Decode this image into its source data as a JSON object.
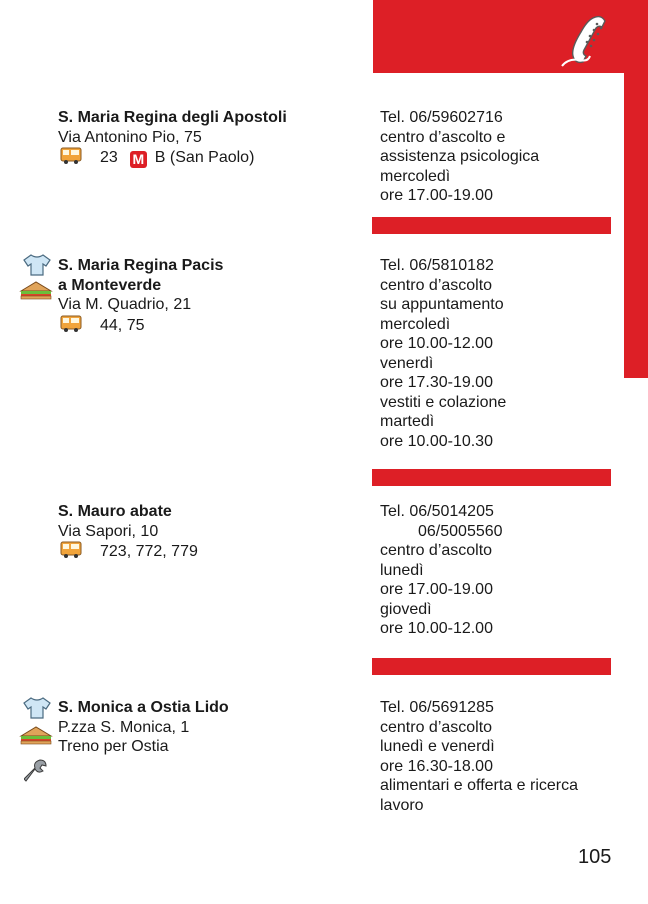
{
  "entries": [
    {
      "title": [
        "S. Maria Regina degli Apostoli"
      ],
      "address": "Via Antonino Pio, 75",
      "transport": {
        "bus": "23",
        "metro_symbol": "M",
        "metro": "B (San Paolo)"
      },
      "right": [
        "Tel. 06/59602716",
        "centro d’ascolto e",
        "assistenza psicologica",
        "mercoledì",
        "ore 17.00-19.00"
      ],
      "icons": []
    },
    {
      "title": [
        "S. Maria Regina Pacis",
        "a Monteverde"
      ],
      "address": "Via M. Quadrio, 21",
      "transport": {
        "bus": "44, 75"
      },
      "right": [
        "Tel. 06/5810182",
        "centro d’ascolto",
        "su appuntamento",
        "mercoledì",
        "ore 10.00-12.00",
        "venerdì",
        "ore 17.30-19.00",
        "vestiti e colazione",
        "martedì",
        "ore 10.00-10.30"
      ],
      "icons": [
        "tshirt-icon",
        "sandwich-icon"
      ]
    },
    {
      "title": [
        "S. Mauro abate"
      ],
      "address": "Via Sapori, 10",
      "transport": {
        "bus": "723, 772, 779"
      },
      "right": [
        "Tel. 06/5014205",
        "06/5005560",
        "centro d’ascolto",
        "lunedì",
        "ore 17.00-19.00",
        "giovedì",
        "ore 10.00-12.00"
      ],
      "icons": []
    },
    {
      "title": [
        "S. Monica a Ostia Lido"
      ],
      "address": "P.zza S. Monica, 1",
      "transport_text": "Treno per Ostia",
      "right": [
        "Tel. 06/5691285",
        "centro d’ascolto",
        "lunedì e venerdì",
        "ore 16.30-18.00",
        "alimentari e offerta e ricerca",
        "lavoro"
      ],
      "icons": [
        "tshirt-icon",
        "sandwich-icon",
        "wrench-icon"
      ]
    }
  ],
  "page_number": "105",
  "colors": {
    "accent": "#dd1f26"
  }
}
